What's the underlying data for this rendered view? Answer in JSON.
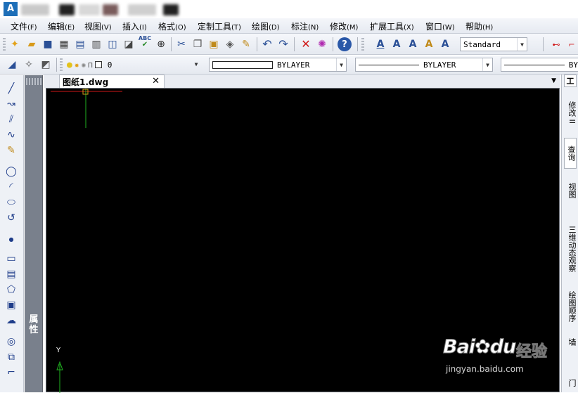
{
  "titlebar": {
    "app_icon_text": "A"
  },
  "menu": [
    {
      "label": "文件",
      "key": "(F)"
    },
    {
      "label": "编辑",
      "key": "(E)"
    },
    {
      "label": "视图",
      "key": "(V)"
    },
    {
      "label": "插入",
      "key": "(I)"
    },
    {
      "label": "格式",
      "key": "(O)"
    },
    {
      "label": "定制工具",
      "key": "(T)"
    },
    {
      "label": "绘图",
      "key": "(D)"
    },
    {
      "label": "标注",
      "key": "(N)"
    },
    {
      "label": "修改",
      "key": "(M)"
    },
    {
      "label": "扩展工具",
      "key": "(X)"
    },
    {
      "label": "窗口",
      "key": "(W)"
    },
    {
      "label": "帮助",
      "key": "(H)"
    }
  ],
  "toolbar": {
    "text_style_value": "Standard",
    "layer_value": "0",
    "color_value": "BYLAYER",
    "linetype_value": "BYLAYER",
    "lineweight_value": "BY",
    "abc_label": "ABC"
  },
  "properties_panel": {
    "label": "属性"
  },
  "document": {
    "tab_label": "图纸1.dwg",
    "close_glyph": "✕"
  },
  "canvas": {
    "background": "#000000",
    "ucs_y_label": "Y"
  },
  "right_panel": {
    "header": "工",
    "tabs": [
      "修改 II",
      "查询",
      "视图",
      "三维动态观察",
      "绘图顺序",
      "墙",
      "门"
    ]
  },
  "watermark": {
    "brand": "Bai",
    "brand2": "du",
    "product": "经验",
    "url": "jingyan.baidu.com"
  },
  "colors": {
    "accent_blue": "#1e6fb8",
    "crosshair_red": "#d01818",
    "crosshair_green": "#1fb21f"
  }
}
